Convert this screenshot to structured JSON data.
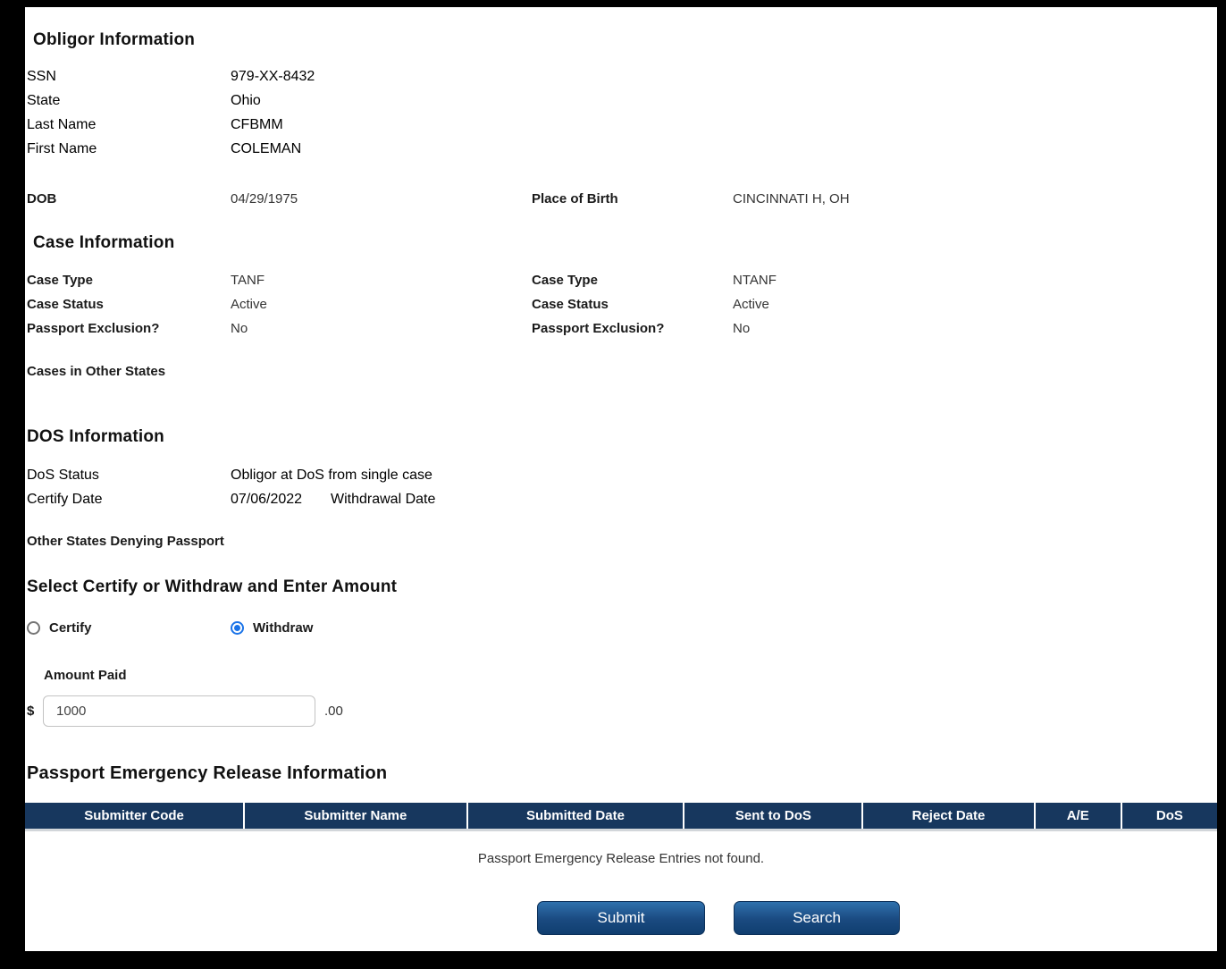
{
  "obligor_information": {
    "heading": "Obligor Information",
    "fields": [
      {
        "label": "SSN",
        "value": "979-XX-8432"
      },
      {
        "label": "State",
        "value": "Ohio"
      },
      {
        "label": "Last Name",
        "value": "CFBMM"
      },
      {
        "label": "First Name",
        "value": "COLEMAN"
      }
    ],
    "dob": {
      "label": "DOB",
      "value": "04/29/1975"
    },
    "place_of_birth": {
      "label": "Place of Birth",
      "value": "CINCINNATI H, OH"
    }
  },
  "case_information": {
    "heading": "Case Information",
    "left": [
      {
        "label": "Case Type",
        "value": "TANF"
      },
      {
        "label": "Case Status",
        "value": "Active"
      },
      {
        "label": "Passport Exclusion?",
        "value": "No"
      }
    ],
    "right": [
      {
        "label": "Case Type",
        "value": "NTANF"
      },
      {
        "label": "Case Status",
        "value": "Active"
      },
      {
        "label": "Passport Exclusion?",
        "value": "No"
      }
    ],
    "cases_in_other_states_label": "Cases in Other States"
  },
  "dos_information": {
    "heading": "DOS Information",
    "dos_status": {
      "label": "DoS Status",
      "value": "Obligor at DoS from single case"
    },
    "certify_date": {
      "label": "Certify Date",
      "value": "07/06/2022"
    },
    "withdrawal_date_label": "Withdrawal Date",
    "other_states_denying_label": "Other States Denying Passport"
  },
  "certify_withdraw": {
    "heading": "Select Certify or Withdraw and Enter Amount",
    "options": [
      {
        "label": "Certify",
        "selected": false
      },
      {
        "label": "Withdraw",
        "selected": true
      }
    ],
    "amount": {
      "label": "Amount Paid",
      "currency_prefix": "$",
      "value": "1000",
      "cents_suffix": ".00"
    }
  },
  "emergency_release": {
    "heading": "Passport Emergency Release Information",
    "columns": [
      "Submitter Code",
      "Submitter Name",
      "Submitted Date",
      "Sent to DoS",
      "Reject Date",
      "A/E",
      "DoS"
    ],
    "empty_message": "Passport Emergency Release Entries not found."
  },
  "actions": {
    "submit_label": "Submit",
    "search_label": "Search"
  },
  "colors": {
    "table_header_navy": "#17375e",
    "button_gradient_top": "#2f71ad",
    "button_gradient_bottom": "#103e70",
    "radio_selected_blue": "#1a73e8",
    "frame_black": "#000000"
  }
}
